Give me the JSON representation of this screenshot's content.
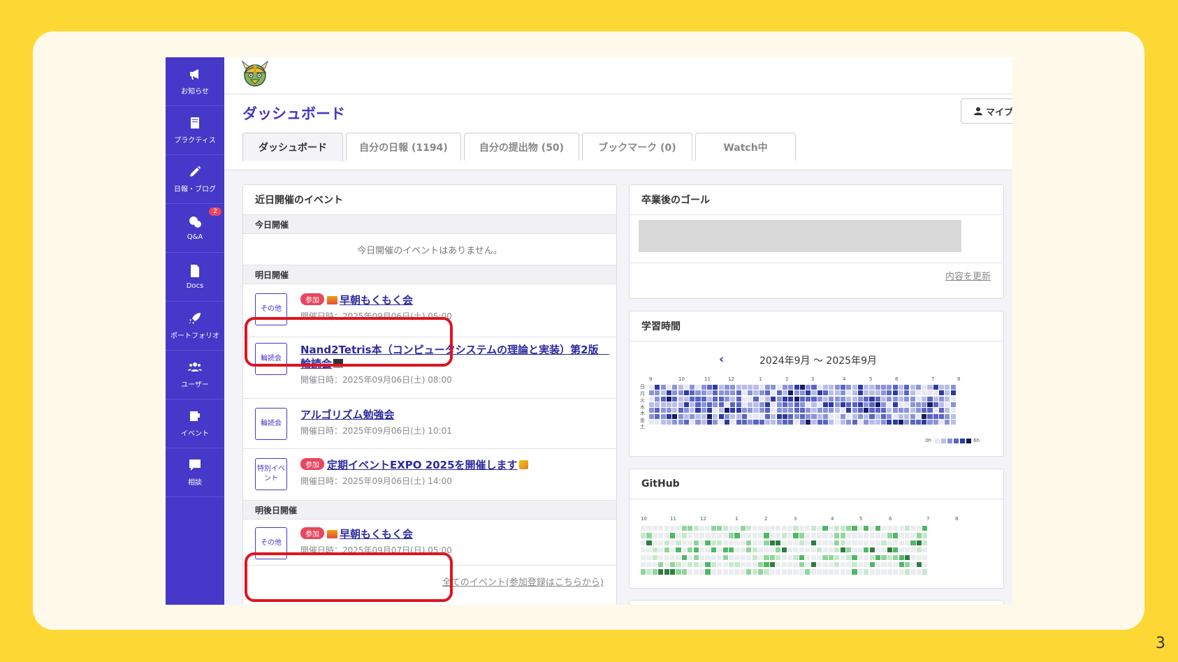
{
  "page_number": "3",
  "sidebar": {
    "items": [
      {
        "label": "お知らせ",
        "icon": "megaphone-icon"
      },
      {
        "label": "プラクティス",
        "icon": "book-icon"
      },
      {
        "label": "日報・ブログ",
        "icon": "pencil-icon"
      },
      {
        "label": "Q&A",
        "icon": "question-chat-icon",
        "badge": "2"
      },
      {
        "label": "Docs",
        "icon": "document-icon"
      },
      {
        "label": "ポートフォリオ",
        "icon": "rocket-icon"
      },
      {
        "label": "ユーザー",
        "icon": "users-icon"
      },
      {
        "label": "イベント",
        "icon": "event-icon"
      },
      {
        "label": "相談",
        "icon": "consult-chat-icon"
      }
    ]
  },
  "header": {
    "logo": "viking-mascot-logo"
  },
  "page": {
    "title": "ダッシュボード",
    "my_button": "マイプ"
  },
  "tabs": [
    {
      "label": "ダッシュボード",
      "active": true
    },
    {
      "label": "自分の日報 (1194)",
      "active": false
    },
    {
      "label": "自分の提出物 (50)",
      "active": false
    },
    {
      "label": "ブックマーク (0)",
      "active": false
    },
    {
      "label": "Watch中",
      "active": false
    }
  ],
  "events_card": {
    "title": "近日開催のイベント",
    "today": {
      "heading": "今日開催",
      "empty": "今日開催のイベントはありません。"
    },
    "tomorrow": {
      "heading": "明日開催",
      "items": [
        {
          "category": "その他",
          "badge": "参加",
          "title": "早朝もくもく会",
          "date": "開催日時：2025年09月06日(土) 05:00"
        },
        {
          "category": "輪読会",
          "title": "Nand2Tetris本（コンピュータシステムの理論と実装）第2版　輪読会",
          "date": "開催日時：2025年09月06日(土) 08:00"
        },
        {
          "category": "輪読会",
          "title": "アルゴリズム勉強会",
          "date": "開催日時：2025年09月06日(土) 10:01"
        },
        {
          "category": "特別イベント",
          "badge": "参加",
          "title": "定期イベントEXPO 2025を開催します",
          "date": "開催日時：2025年09月06日(土) 14:00"
        }
      ]
    },
    "day_after": {
      "heading": "明後日開催",
      "items": [
        {
          "category": "その他",
          "badge": "参加",
          "title": "早朝もくもく会",
          "date": "開催日時：2025年09月07日(日) 05:00"
        }
      ]
    },
    "all_link": "全てのイベント(参加登録はこちらから)"
  },
  "goal_card": {
    "title": "卒業後のゴール",
    "update_link": "内容を更新"
  },
  "study_card": {
    "title": "学習時間",
    "range": "2024年9月 〜 2025年9月",
    "months": [
      "9",
      "10",
      "11",
      "12",
      "1",
      "2",
      "3",
      "4",
      "5",
      "6",
      "7",
      "8"
    ],
    "days": [
      "日",
      "月",
      "火",
      "水",
      "木",
      "金",
      "土"
    ],
    "legend_min": "0h",
    "legend_max": "6h",
    "colors": [
      "#E6E8F5",
      "#B8BEE8",
      "#8A93D8",
      "#5A64C2",
      "#2F3A9E",
      "#141C5E"
    ]
  },
  "github_card": {
    "title": "GitHub",
    "months": [
      "10",
      "11",
      "12",
      "1",
      "2",
      "3",
      "4",
      "5",
      "6",
      "7",
      "8"
    ],
    "colors": [
      "#EBEDF0",
      "#C6E9CC",
      "#8FD69B",
      "#4FB765",
      "#2C7D3E"
    ]
  },
  "accent": "#4638C8",
  "highlight_color": "#E0141E"
}
